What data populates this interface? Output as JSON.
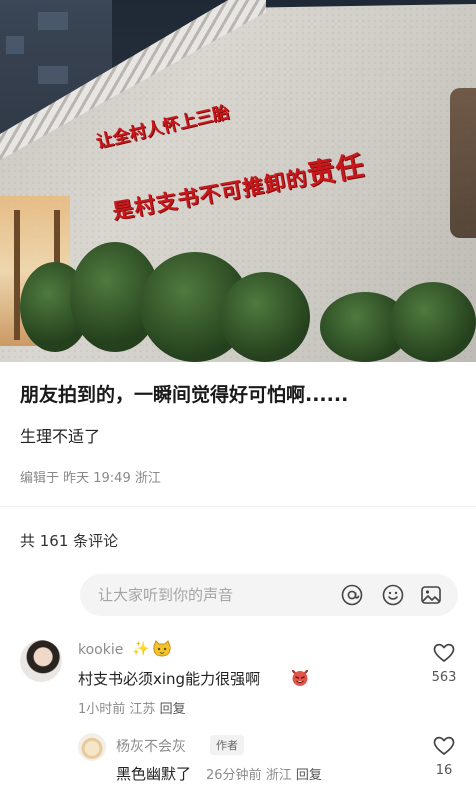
{
  "post": {
    "photo_slogan_line1": "让全村人怀上三胎",
    "photo_slogan_line2_part1": "是村支书不可推卸的",
    "photo_slogan_line2_part2": "责任",
    "title": "朋友拍到的，一瞬间觉得好可怕啊......",
    "body": "生理不适了",
    "meta": "编辑于 昨天 19:49 浙江"
  },
  "comments_header": "共 161 条评论",
  "comment_input": {
    "placeholder": "让大家听到你的声音",
    "value": ""
  },
  "icons": {
    "mention": "at-icon",
    "emoji": "emoji-icon",
    "image": "image-icon",
    "like": "heart-icon"
  },
  "comments": [
    {
      "username": "kookie",
      "username_emoji": "✨",
      "text": "村支书必须xing能力很强啊",
      "time": "1小时前",
      "location": "江苏",
      "reply_label": "回复",
      "likes": "563",
      "replies": [
        {
          "username": "杨灰不会灰",
          "tag": "作者",
          "text": "黑色幽默了",
          "time": "26分钟前",
          "location": "浙江",
          "reply_label": "回复",
          "likes": "16"
        }
      ]
    }
  ],
  "colors": {
    "slogan_red": "#c8181c",
    "input_bg": "#f4f4f5",
    "meta_gray": "#8c8c8c"
  }
}
